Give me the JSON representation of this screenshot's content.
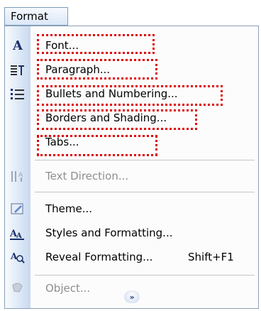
{
  "menubar": {
    "format_label": "Format"
  },
  "menu": {
    "items": [
      {
        "label": "Font...",
        "icon": "font-icon",
        "disabled": false
      },
      {
        "label": "Paragraph...",
        "icon": "paragraph-icon",
        "disabled": false
      },
      {
        "label": "Bullets and Numbering...",
        "icon": "bullets-icon",
        "disabled": false
      },
      {
        "label": "Borders and Shading...",
        "icon": "",
        "disabled": false
      },
      {
        "label": "Tabs...",
        "icon": "",
        "disabled": false
      },
      {
        "label": "Text Direction...",
        "icon": "text-direction-icon",
        "disabled": true
      },
      {
        "label": "Theme...",
        "icon": "theme-icon",
        "disabled": false
      },
      {
        "label": "Styles and Formatting...",
        "icon": "styles-formatting-icon",
        "disabled": false
      },
      {
        "label": "Reveal Formatting...",
        "shortcut": "Shift+F1",
        "icon": "reveal-formatting-icon",
        "disabled": false
      },
      {
        "label": "Object...",
        "icon": "object-icon",
        "disabled": true
      }
    ],
    "expand_icon": "expand-chevron-icon"
  },
  "colors": {
    "highlight": "#e00000",
    "menu_border": "#8aa0b8",
    "icon_column": "#c8d9ef"
  }
}
